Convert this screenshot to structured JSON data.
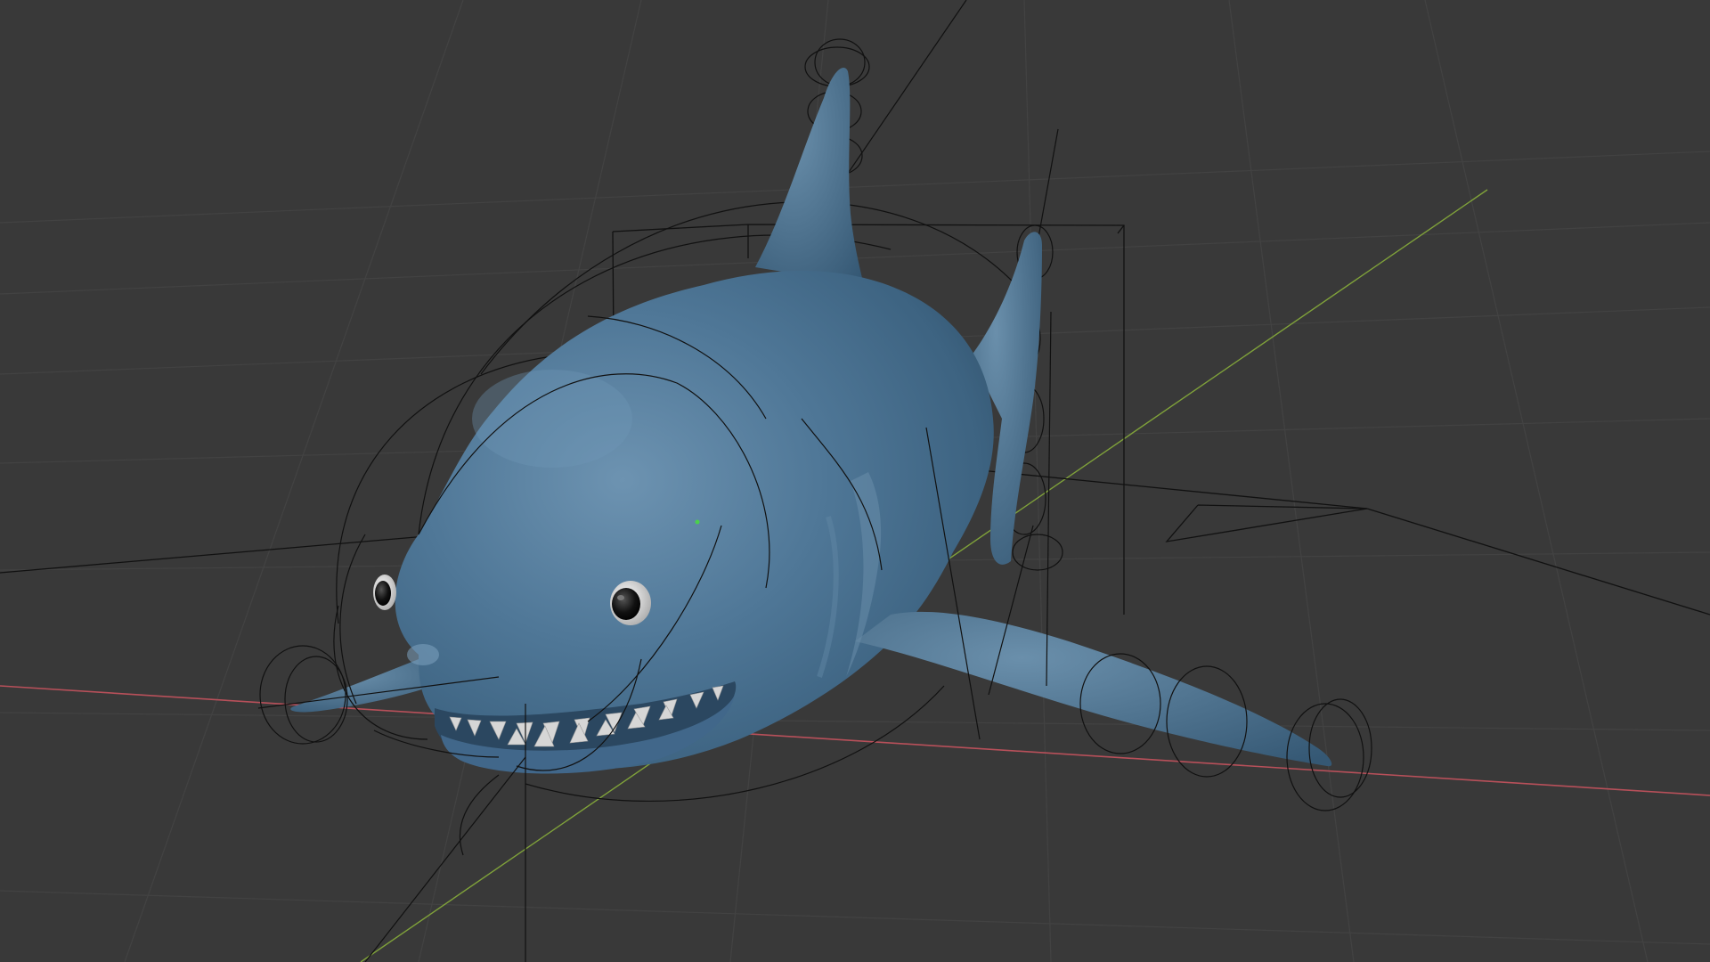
{
  "viewport": {
    "mode": "3d-viewport",
    "shading": "solid",
    "overlays": [
      "grid-floor",
      "x-axis",
      "y-axis",
      "armature-wire",
      "camera-wire",
      "light-wire",
      "bounding-box"
    ]
  },
  "scene": {
    "object": "shark-mesh",
    "object_color": "#4a6f8c",
    "eye_color": "#111111",
    "teeth_color": "#d6d6d6",
    "background_color": "#393939",
    "grid_color": "#4a4a4a",
    "x_axis_color": "#b8505a",
    "y_axis_color": "#7fa13a",
    "wire_color": "#111111"
  }
}
